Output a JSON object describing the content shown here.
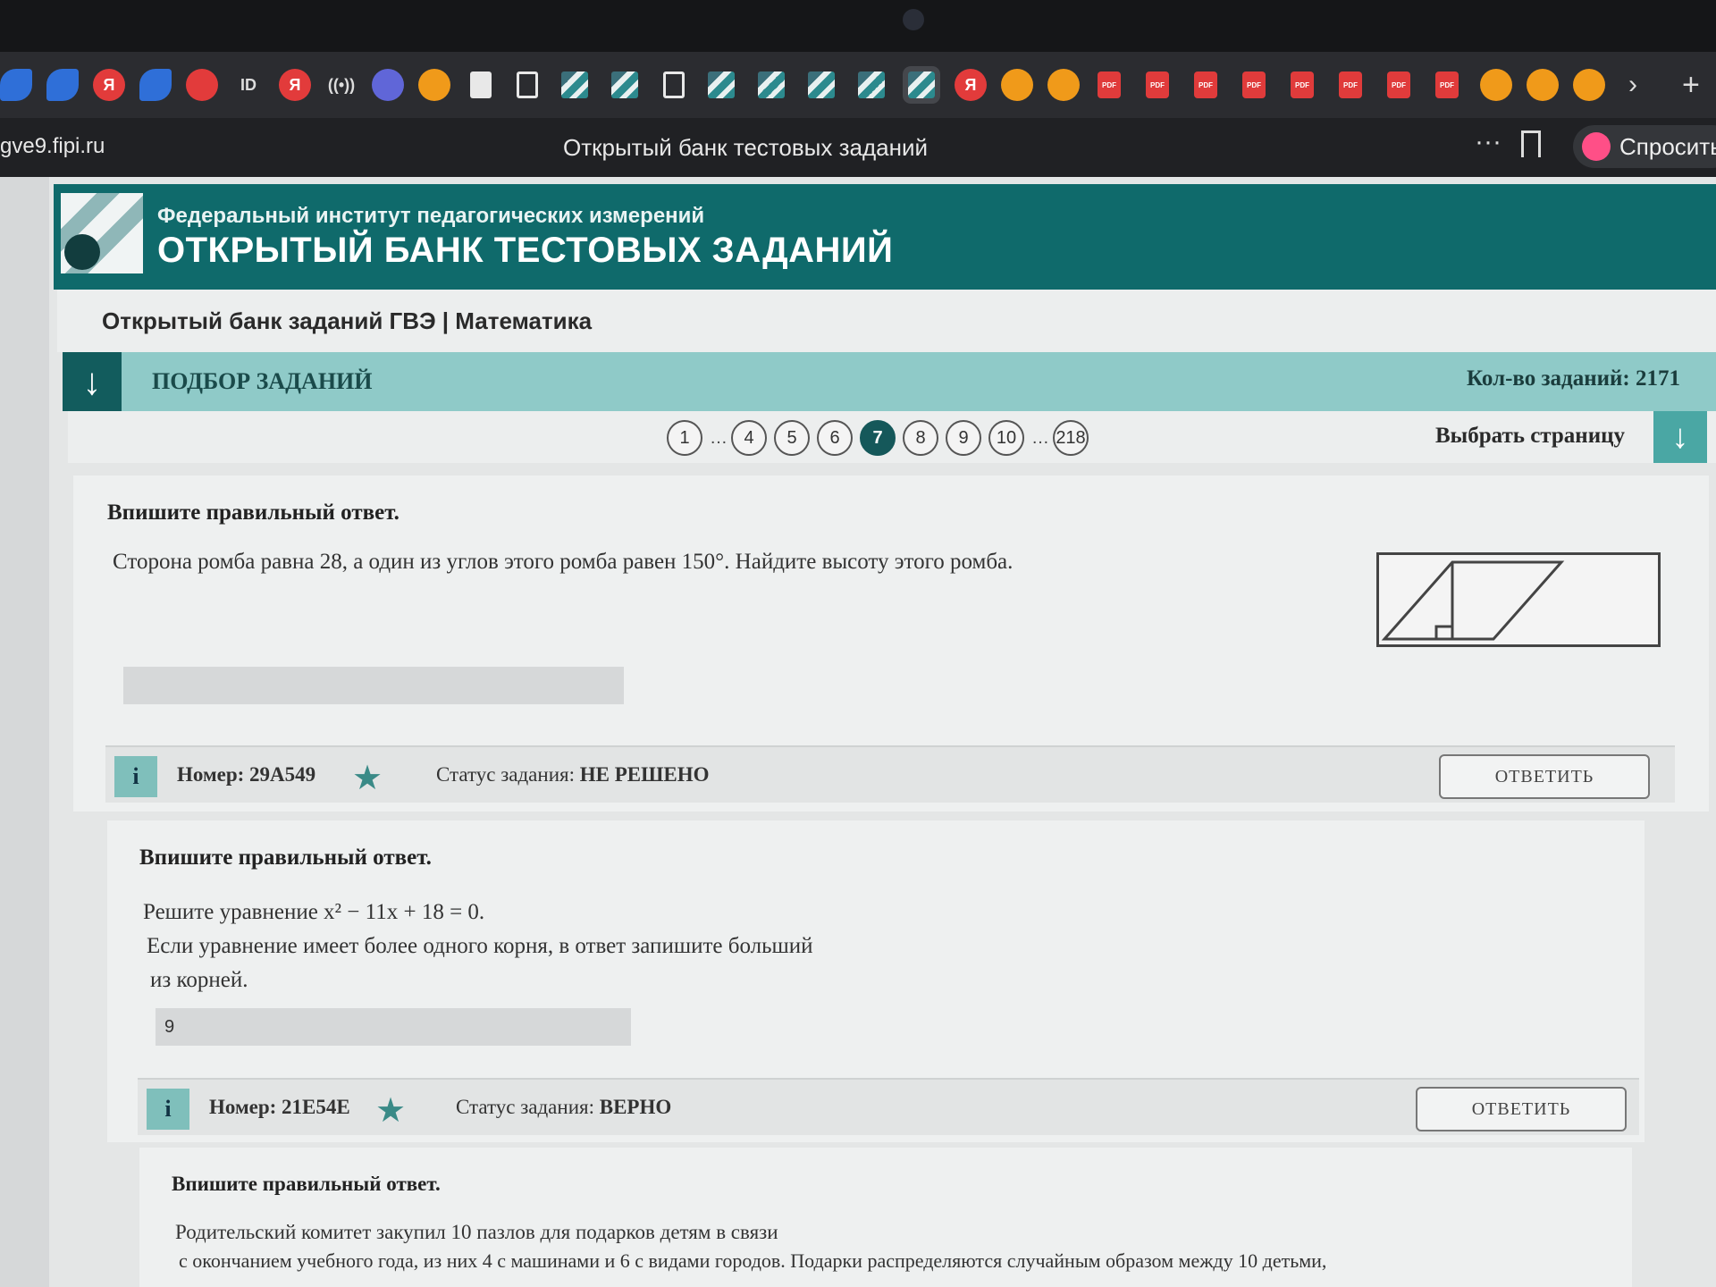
{
  "browser": {
    "url": "gve9.fipi.ru",
    "tab_title": "Открытый банк тестовых заданий",
    "more": "···",
    "ask_label": "Спросить",
    "bookmark_id_label": "ID",
    "bookmark_ya_label": "Я",
    "bookmark_pdf_label": "PDF"
  },
  "header": {
    "org_name": "Федеральный институт педагогических измерений",
    "bank_title": "ОТКРЫТЫЙ БАНК ТЕСТОВЫХ ЗАДАНИЙ",
    "subtitle": "Открытый банк заданий ГВЭ | Математика"
  },
  "selection": {
    "title": "ПОДБОР ЗАДАНИЙ",
    "count_label": "Кол-во заданий: 2171",
    "choose_page": "Выбрать страницу"
  },
  "pagination": {
    "pages": [
      "1",
      "…",
      "4",
      "5",
      "6",
      "7",
      "8",
      "9",
      "10",
      "…",
      "218"
    ],
    "current": "7"
  },
  "tasks": [
    {
      "instruction": "Впишите правильный ответ.",
      "text": "Сторона ромба равна 28, а один из углов этого ромба равен 150°. Найдите высоту этого ромба.",
      "answer": "",
      "number": "Номер: 29A549",
      "status_label": "Статус задания:",
      "status_value": "НЕ РЕШЕНО",
      "button": "ОТВЕТИТЬ"
    },
    {
      "instruction": "Впишите правильный ответ.",
      "text_line1": "Решите уравнение x² − 11x + 18 = 0.",
      "text_line2": "Если уравнение имеет более одного корня, в ответ запишите больший",
      "text_line3": "из корней.",
      "answer": "9",
      "number": "Номер: 21E54E",
      "status_label": "Статус задания:",
      "status_value": "ВЕРНО",
      "button": "ОТВЕТИТЬ"
    },
    {
      "instruction": "Впишите правильный ответ.",
      "text_line1": "Родительский комитет закупил 10 пазлов для подарков детям в связи",
      "text_line2": "с окончанием учебного года, из них 4 с машинами и 6 с видами городов. Подарки распределяются случайным образом между 10 детьми,"
    }
  ],
  "colors": {
    "brand": "#0f6a6b",
    "accent": "#8fcac8",
    "dark_teal": "#15585a"
  }
}
